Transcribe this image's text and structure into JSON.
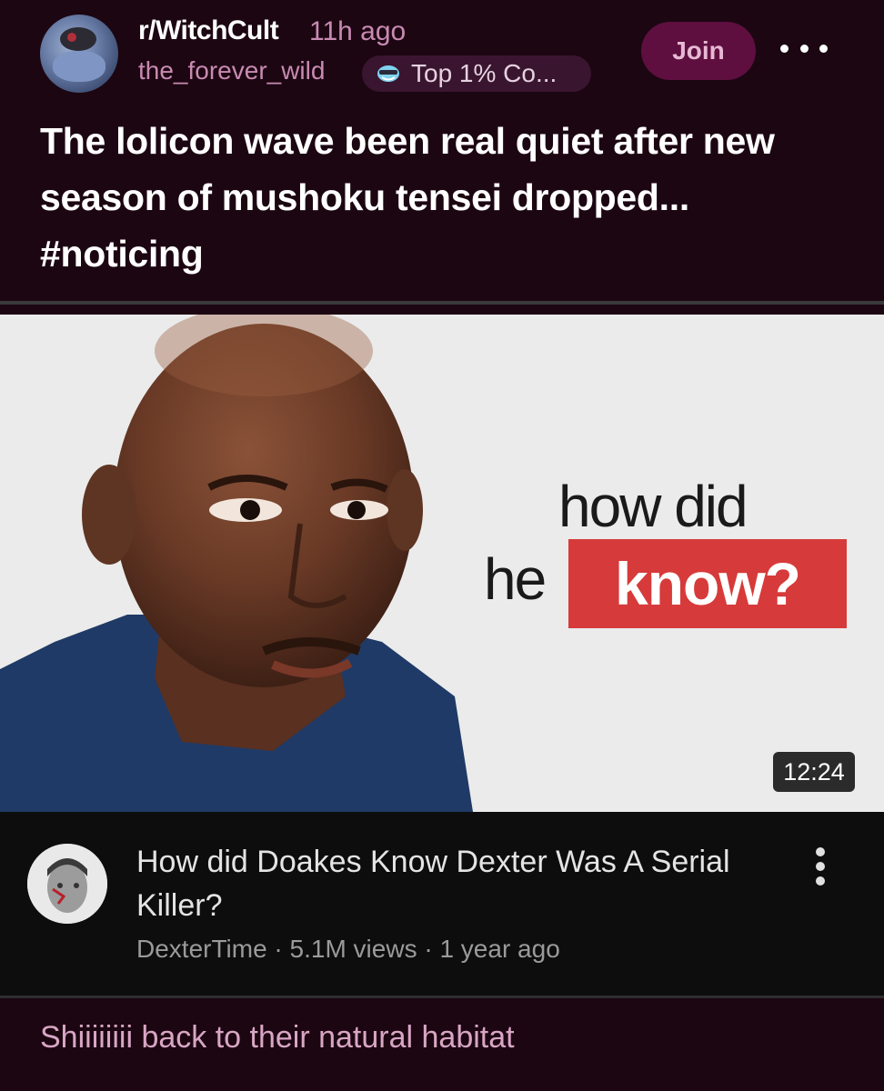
{
  "post": {
    "subreddit": "r/WitchCult",
    "time_ago": "11h ago",
    "username": "the_forever_wild",
    "flair": "Top 1% Co...",
    "join_label": "Join",
    "title": "The lolicon wave been real quiet after new season of mushoku tensei dropped... #noticing"
  },
  "thumbnail": {
    "text_line1": "how did",
    "text_line2_plain": "he",
    "text_line2_highlight": "know?",
    "duration": "12:24",
    "highlight_color": "#d73a3a"
  },
  "video": {
    "title": "How did Doakes Know Dexter Was A Serial Killer?",
    "meta": "DexterTime · 5.1M views · 1 year ago"
  },
  "comment": {
    "text": "Shiiiiiiii back to their natural habitat"
  },
  "colors": {
    "background": "#1c0612",
    "accent": "#c98ab2",
    "join_bg": "#5e0f3f"
  }
}
